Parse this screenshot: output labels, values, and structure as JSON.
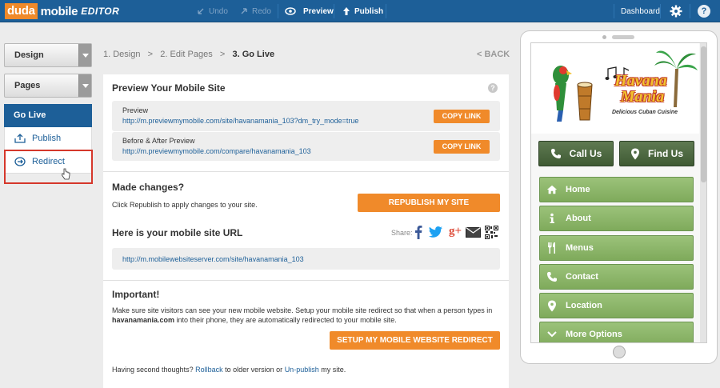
{
  "toolbar": {
    "logo_brand": "duda",
    "logo_product": "mobile",
    "logo_suffix": "EDITOR",
    "undo": "Undo",
    "redo": "Redo",
    "preview": "Preview",
    "publish": "Publish",
    "dashboard": "Dashboard",
    "help": "?"
  },
  "sidebar": {
    "design": "Design",
    "pages": "Pages",
    "go_live": "Go Live",
    "publish": "Publish",
    "redirect": "Redirect"
  },
  "breadcrumb": {
    "step1": "1. Design",
    "sep1": ">",
    "step2": "2. Edit Pages",
    "sep2": ">",
    "step3": "3. Go Live",
    "back": "< BACK"
  },
  "preview_section": {
    "title": "Preview Your Mobile Site",
    "help": "?",
    "preview_label": "Preview",
    "preview_url": "http://m.previewmymobile.com/site/havanamania_103?dm_try_mode=true",
    "before_after_label": "Before & After Preview",
    "before_after_url": "http://m.previewmymobile.com/compare/havanamania_103",
    "copy_link": "COPY LINK"
  },
  "changes_section": {
    "title": "Made changes?",
    "text": "Click Republish to apply changes to your site.",
    "button": "REPUBLISH MY SITE"
  },
  "url_section": {
    "title": "Here is your mobile site URL",
    "share": "Share:",
    "url": "http://m.mobilewebsiteserver.com/site/havanamania_103"
  },
  "important_section": {
    "title": "Important!",
    "text_1": "Make sure site visitors can see your new mobile website. Setup your mobile site redirect so that when a person types in",
    "domain": "havanamania.com",
    "text_2": " into their phone, they are automatically redirected to your mobile site.",
    "button": "SETUP MY MOBILE WEBSITE REDIRECT",
    "footer_1": "Having second thoughts?",
    "rollback": "Rollback",
    "footer_2": "to older version or",
    "unpublish": "Un-publish",
    "footer_3": "my site."
  },
  "phone_preview": {
    "logo_line1": "Havana",
    "logo_line2": "Mania",
    "logo_tagline": "Delicious Cuban Cuisine",
    "call_us": "Call Us",
    "find_us": "Find Us",
    "nav": [
      "Home",
      "About",
      "Menus",
      "Contact",
      "Location",
      "More Options"
    ]
  },
  "colors": {
    "topbar": "#1d5f98",
    "accent_orange": "#f08a2a",
    "nav_green": "#8fb96c",
    "action_dark_green": "#4e6944",
    "highlight_red": "#d5372b"
  },
  "icons": [
    "undo-icon",
    "redo-icon",
    "eye-icon",
    "upload-arrow-icon",
    "gear-icon",
    "help-icon",
    "publish-icon",
    "redirect-icon",
    "facebook-icon",
    "twitter-icon",
    "google-plus-icon",
    "email-icon",
    "qr-code-icon",
    "phone-icon",
    "map-pin-icon",
    "home-icon",
    "info-icon",
    "fork-knife-icon",
    "chevron-down-icon"
  ]
}
